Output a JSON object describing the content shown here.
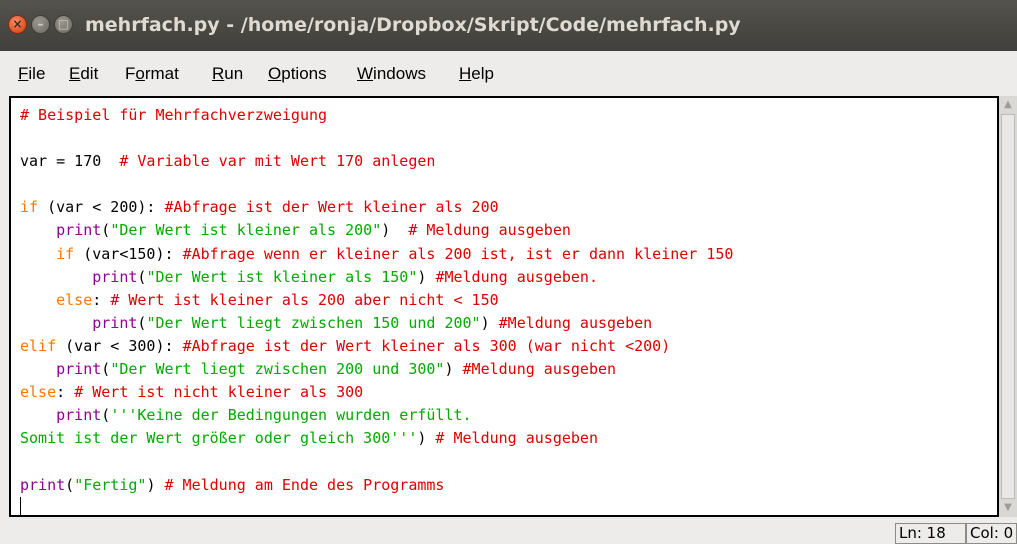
{
  "window": {
    "title": "mehrfach.py - /home/ronja/Dropbox/Skript/Code/mehrfach.py",
    "close_glyph": "×",
    "min_glyph": "–",
    "max_glyph": "□"
  },
  "menu": [
    {
      "pre": "",
      "u": "F",
      "post": "ile"
    },
    {
      "pre": "",
      "u": "E",
      "post": "dit"
    },
    {
      "pre": "F",
      "u": "o",
      "post": "rmat"
    },
    {
      "pre": "",
      "u": "R",
      "post": "un"
    },
    {
      "pre": "",
      "u": "O",
      "post": "ptions"
    },
    {
      "pre": "",
      "u": "W",
      "post": "indows"
    },
    {
      "pre": "",
      "u": "H",
      "post": "elp"
    }
  ],
  "code_lines": [
    [
      [
        "cm",
        "# Beispiel für Mehrfachverzweigung"
      ]
    ],
    [],
    [
      [
        "",
        "var = 170  "
      ],
      [
        "cm",
        "# Variable var mit Wert 170 anlegen"
      ]
    ],
    [],
    [
      [
        "kw",
        "if"
      ],
      [
        "",
        " (var < 200): "
      ],
      [
        "cm",
        "#Abfrage ist der Wert kleiner als 200"
      ]
    ],
    [
      [
        "",
        "    "
      ],
      [
        "bi",
        "print"
      ],
      [
        "",
        "("
      ],
      [
        "st",
        "\"Der Wert ist kleiner als 200\""
      ],
      [
        "",
        ")  "
      ],
      [
        "cm",
        "# Meldung ausgeben"
      ]
    ],
    [
      [
        "",
        "    "
      ],
      [
        "kw",
        "if"
      ],
      [
        "",
        " (var<150): "
      ],
      [
        "cm",
        "#Abfrage wenn er kleiner als 200 ist, ist er dann kleiner 150"
      ]
    ],
    [
      [
        "",
        "        "
      ],
      [
        "bi",
        "print"
      ],
      [
        "",
        "("
      ],
      [
        "st",
        "\"Der Wert ist kleiner als 150\""
      ],
      [
        "",
        ") "
      ],
      [
        "cm",
        "#Meldung ausgeben."
      ]
    ],
    [
      [
        "",
        "    "
      ],
      [
        "kw",
        "else"
      ],
      [
        "",
        ": "
      ],
      [
        "cm",
        "# Wert ist kleiner als 200 aber nicht < 150"
      ]
    ],
    [
      [
        "",
        "        "
      ],
      [
        "bi",
        "print"
      ],
      [
        "",
        "("
      ],
      [
        "st",
        "\"Der Wert liegt zwischen 150 und 200\""
      ],
      [
        "",
        ") "
      ],
      [
        "cm",
        "#Meldung ausgeben"
      ]
    ],
    [
      [
        "kw",
        "elif"
      ],
      [
        "",
        " (var < 300): "
      ],
      [
        "cm",
        "#Abfrage ist der Wert kleiner als 300 (war nicht <200)"
      ]
    ],
    [
      [
        "",
        "    "
      ],
      [
        "bi",
        "print"
      ],
      [
        "",
        "("
      ],
      [
        "st",
        "\"Der Wert liegt zwischen 200 und 300\""
      ],
      [
        "",
        ") "
      ],
      [
        "cm",
        "#Meldung ausgeben"
      ]
    ],
    [
      [
        "kw",
        "else"
      ],
      [
        "",
        ": "
      ],
      [
        "cm",
        "# Wert ist nicht kleiner als 300"
      ]
    ],
    [
      [
        "",
        "    "
      ],
      [
        "bi",
        "print"
      ],
      [
        "",
        "("
      ],
      [
        "st",
        "'''Keine der Bedingungen wurden erfüllt."
      ]
    ],
    [
      [
        "st",
        "Somit ist der Wert größer oder gleich 300'''"
      ],
      [
        "",
        ") "
      ],
      [
        "cm",
        "# Meldung ausgeben"
      ]
    ],
    [],
    [
      [
        "bi",
        "print"
      ],
      [
        "",
        "("
      ],
      [
        "st",
        "\"Fertig\""
      ],
      [
        "",
        ") "
      ],
      [
        "cm",
        "# Meldung am Ende des Programms"
      ]
    ],
    []
  ],
  "status": {
    "line": "Ln: 18",
    "col": "Col: 0"
  },
  "colors": {
    "keyword": "#ff7700",
    "comment": "#dd0000",
    "string": "#00aa00",
    "builtin": "#900090",
    "titlebar": "#4a4944"
  }
}
